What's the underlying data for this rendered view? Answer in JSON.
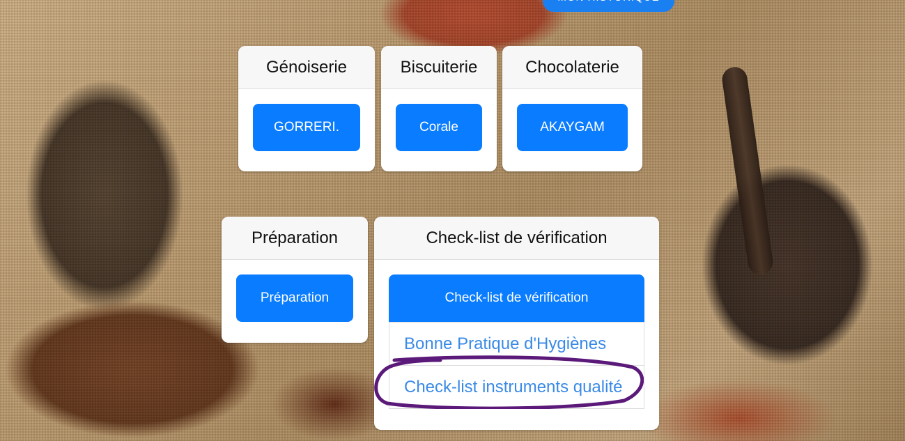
{
  "top_button": {
    "label": "MON HISTORIQUE"
  },
  "cards_row1": [
    {
      "title": "Génoiserie",
      "button": "GORRERI."
    },
    {
      "title": "Biscuiterie",
      "button": "Corale"
    },
    {
      "title": "Chocolaterie",
      "button": "AKAYGAM"
    }
  ],
  "cards_row2": {
    "preparation": {
      "title": "Préparation",
      "button": "Préparation"
    },
    "checklist": {
      "title": "Check-list de vérification",
      "button": "Check-list de vérification",
      "items": [
        "Bonne Pratique d'Hygiènes",
        "Check-list instruments qualité"
      ]
    }
  },
  "colors": {
    "accent": "#0a7cff",
    "link": "#3a8ae6",
    "annotation": "#5b1a7a"
  }
}
